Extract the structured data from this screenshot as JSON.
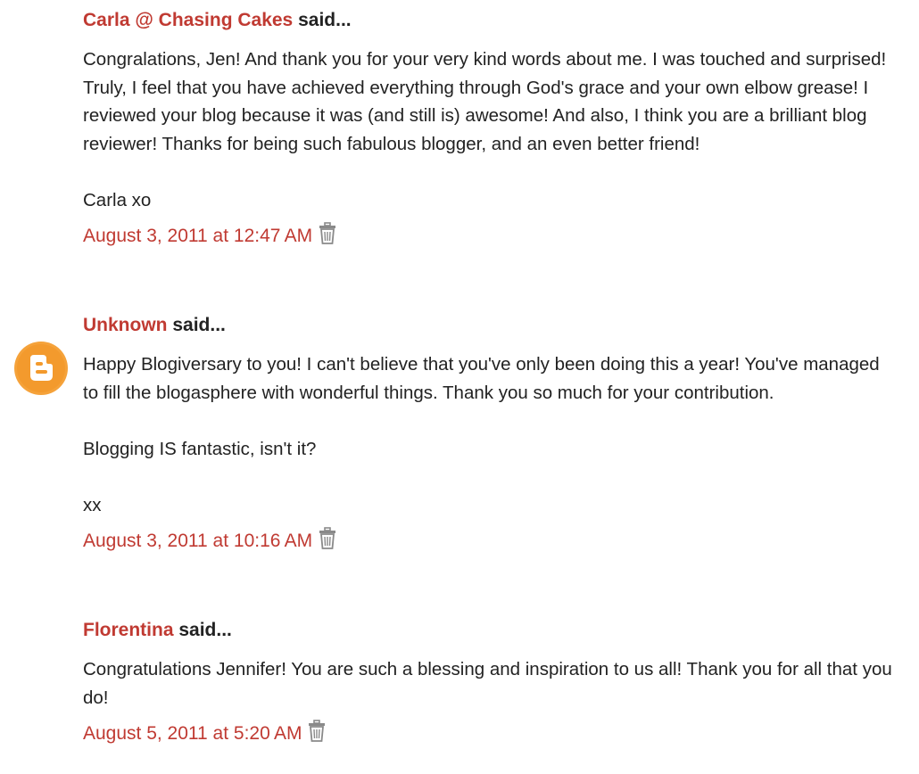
{
  "comments": [
    {
      "author": "Carla @ Chasing Cakes",
      "said": "said...",
      "paragraphs": [
        "Congralations, Jen! And thank you for your very kind words about me. I was touched and surprised! Truly, I feel that you have achieved everything through God's grace and your own elbow grease! I reviewed your blog because it was (and still is) awesome! And also, I think you are a brilliant blog reviewer! Thanks for being such fabulous blogger, and an even better friend!",
        "Carla xo"
      ],
      "timestamp": "August 3, 2011 at 12:47 AM",
      "avatar": null
    },
    {
      "author": "Unknown",
      "said": "said...",
      "paragraphs": [
        "Happy Blogiversary to you! I can't believe that you've only been doing this a year! You've managed to fill the blogasphere with wonderful things. Thank you so much for your contribution.",
        "Blogging IS fantastic, isn't it?",
        "xx"
      ],
      "timestamp": "August 3, 2011 at 10:16 AM",
      "avatar": "blogger-logo-icon"
    },
    {
      "author": "Florentina",
      "said": "said...",
      "paragraphs": [
        "Congratulations Jennifer! You are such a blessing and inspiration to us all! Thank you for all that you do!"
      ],
      "timestamp": "August 5, 2011 at 5:20 AM",
      "avatar": null
    }
  ],
  "icons": {
    "delete": "trash-icon",
    "avatar": "blogger-logo-icon"
  },
  "colors": {
    "link": "#c03a32",
    "text": "#222222",
    "avatar": "#f5a23a",
    "trash": "#8a8a8a"
  }
}
